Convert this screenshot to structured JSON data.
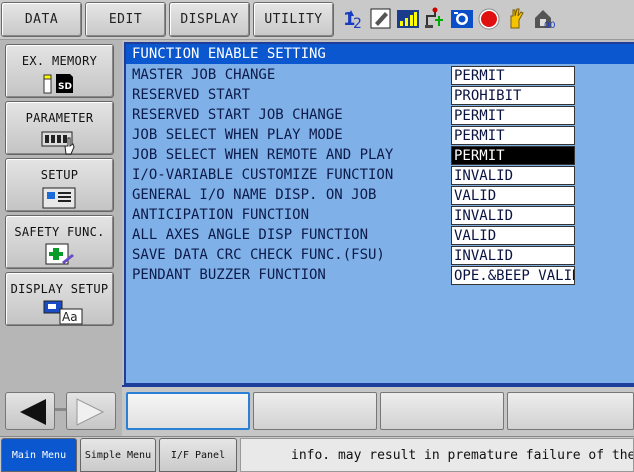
{
  "top_menu": [
    "DATA",
    "EDIT",
    "DISPLAY",
    "UTILITY"
  ],
  "status_icons": [
    "axis-number-icon",
    "edit-mode-icon",
    "signal-bars-icon",
    "tool-frame-icon",
    "camera-icon",
    "stop-red-icon",
    "hand-hold-icon",
    "security-icon"
  ],
  "side_menu": [
    {
      "label": "EX. MEMORY",
      "icon": "sd-card-icon"
    },
    {
      "label": "PARAMETER",
      "icon": "parameter-icon"
    },
    {
      "label": "SETUP",
      "icon": "setup-icon"
    },
    {
      "label": "SAFETY FUNC.",
      "icon": "safety-icon"
    },
    {
      "label": "DISPLAY SETUP",
      "icon": "display-setup-icon"
    }
  ],
  "screen_title": "FUNCTION ENABLE SETTING",
  "settings": [
    {
      "name": "MASTER JOB CHANGE",
      "value": "PERMIT"
    },
    {
      "name": "RESERVED START",
      "value": "PROHIBIT"
    },
    {
      "name": "RESERVED START JOB CHANGE",
      "value": "PERMIT"
    },
    {
      "name": "JOB SELECT WHEN PLAY MODE",
      "value": "PERMIT"
    },
    {
      "name": "JOB SELECT WHEN REMOTE AND PLAY",
      "value": "PERMIT"
    },
    {
      "name": "I/O-VARIABLE CUSTOMIZE FUNCTION",
      "value": "INVALID"
    },
    {
      "name": "GENERAL I/O NAME DISP. ON JOB",
      "value": "VALID"
    },
    {
      "name": "ANTICIPATION FUNCTION",
      "value": "INVALID"
    },
    {
      "name": "ALL AXES ANGLE DISP FUNCTION",
      "value": "VALID"
    },
    {
      "name": "SAVE DATA CRC CHECK FUNC.(FSU)",
      "value": "INVALID"
    },
    {
      "name": "PENDANT BUZZER FUNCTION",
      "value": "OPE.&BEEP VALID"
    }
  ],
  "selected_index": 4,
  "status_tabs": [
    "Main Menu",
    "Simple Menu",
    "I/F Panel"
  ],
  "message": "info. may result in premature failure of the robo"
}
